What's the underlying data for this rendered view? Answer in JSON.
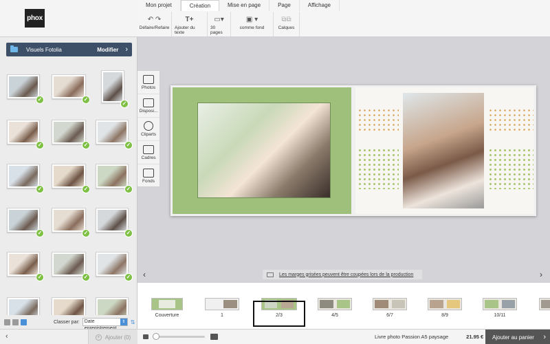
{
  "logo": "phox",
  "left_panel": {
    "folder_title": "Visuels Fotolia",
    "modify_label": "Modifier",
    "sort_label": "Classer par:",
    "sort_value": "Date enregistrement",
    "add_label": "Ajouter (0)"
  },
  "tabs": [
    "Mon projet",
    "Création",
    "Mise en page",
    "Page",
    "Affichage"
  ],
  "toolbar": {
    "undo_label": "Défaire/Refaire",
    "add_text_label": "Ajouter du texte",
    "pages_label": "30 pages",
    "bg_label": "comme fond",
    "layers_label": "Calques"
  },
  "side_tools": [
    "Photos",
    "Disposi...",
    "Cliparts",
    "Cadres",
    "Fonds"
  ],
  "notice": "Les marges grisées peuvent être coupées lors de la production",
  "filmstrip": [
    "Couverture",
    "1",
    "2/3",
    "4/5",
    "6/7",
    "8/9",
    "10/11"
  ],
  "bottom": {
    "product": "Livre photo Passion A5 paysage",
    "price": "21.95 €",
    "cart_label": "Ajouter au panier"
  },
  "colors": {
    "accent": "#4a90d9",
    "check": "#7ec043",
    "folder_bar": "#3e5068",
    "page_green": "#9ec07a"
  }
}
